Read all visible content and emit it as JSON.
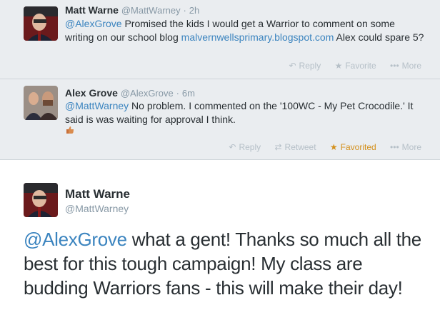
{
  "tweets": [
    {
      "name": "Matt Warne",
      "handle": "@MattWarney",
      "time": "2h",
      "mention": "@AlexGrove",
      "text_a": " Promised the kids I would get a Warrior to comment on some writing on our school blog ",
      "link": "malvernwellsprimary.blogspot.com",
      "text_b": " Alex could spare 5?",
      "actions": {
        "reply": "Reply",
        "favorite": "Favorite",
        "more": "More"
      }
    },
    {
      "name": "Alex Grove",
      "handle": "@AlexGrove",
      "time": "6m",
      "mention": "@MattWarney",
      "text": " No problem. I commented on the '100WC - My Pet Crocodile.' It said is was waiting for approval I think.",
      "actions": {
        "reply": "Reply",
        "retweet": "Retweet",
        "favorited": "Favorited",
        "more": "More"
      }
    }
  ],
  "main": {
    "name": "Matt Warne",
    "handle": "@MattWarney",
    "mention": "@AlexGrove",
    "text": " what a gent! Thanks so much all the best for this tough campaign! My class are budding Warriors fans - this will make their day!"
  },
  "icons": {
    "reply": "reply-icon",
    "favorite": "star-icon",
    "retweet": "retweet-icon",
    "more": "more-dots-icon"
  },
  "colors": {
    "link": "#3b84bf",
    "favorited": "#d4901c",
    "muted": "#8899a6",
    "compact_bg": "#eaedf0"
  }
}
